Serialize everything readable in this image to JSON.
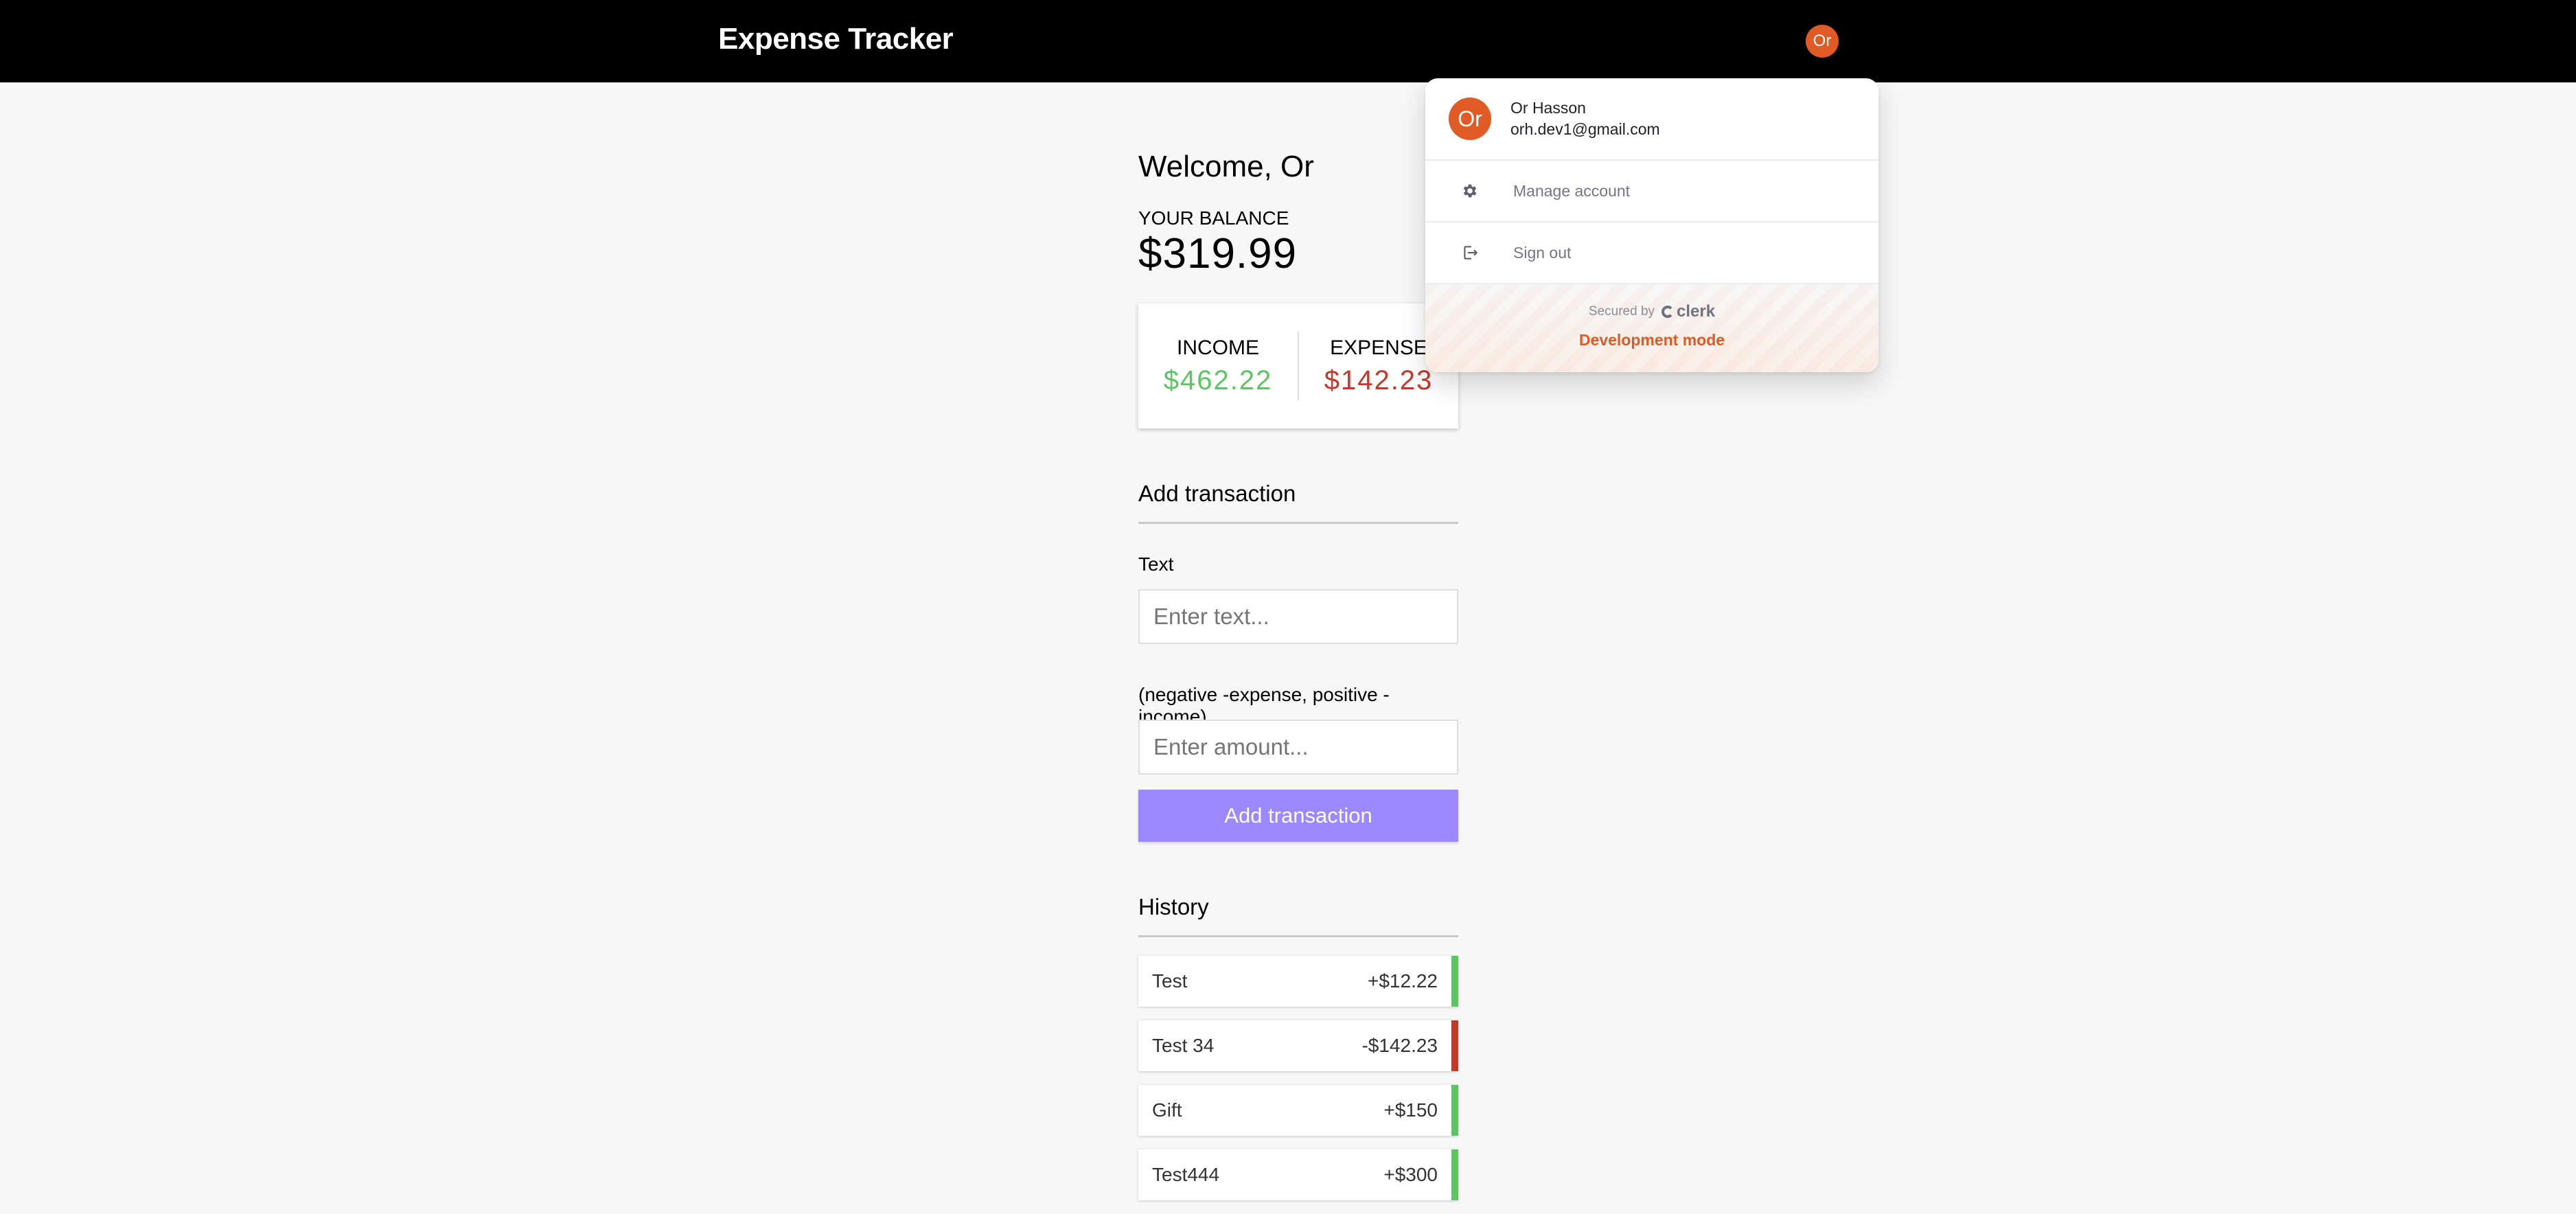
{
  "header": {
    "title": "Expense Tracker",
    "avatar_initials": "Or"
  },
  "welcome": "Welcome, Or",
  "balance": {
    "label": "YOUR BALANCE",
    "value": "$319.99"
  },
  "summary": {
    "income_label": "INCOME",
    "income_value": "$462.22",
    "expense_label": "EXPENSE",
    "expense_value": "$142.23"
  },
  "form": {
    "title": "Add transaction",
    "text_label": "Text",
    "text_placeholder": "Enter text...",
    "amount_label": "(negative -expense, positive - income)",
    "amount_placeholder": "Enter amount...",
    "submit_label": "Add transaction"
  },
  "history": {
    "title": "History",
    "items": [
      {
        "text": "Test",
        "amount": "+$12.22",
        "type": "income"
      },
      {
        "text": "Test 34",
        "amount": "-$142.23",
        "type": "expense"
      },
      {
        "text": "Gift",
        "amount": "+$150",
        "type": "income"
      },
      {
        "text": "Test444",
        "amount": "+$300",
        "type": "income"
      }
    ]
  },
  "clerk_menu": {
    "avatar_initials": "Or",
    "name": "Or Hasson",
    "email": "orh.dev1@gmail.com",
    "manage_label": "Manage account",
    "signout_label": "Sign out",
    "secured_by": "Secured by",
    "brand": "clerk",
    "dev_mode": "Development mode"
  },
  "colors": {
    "income": "#5ec364",
    "expense": "#c0392b",
    "accent": "#9c88ff",
    "clerk_orange": "#e05a26"
  },
  "icons": {
    "manage": "gear-icon",
    "signout": "sign-out-icon"
  }
}
